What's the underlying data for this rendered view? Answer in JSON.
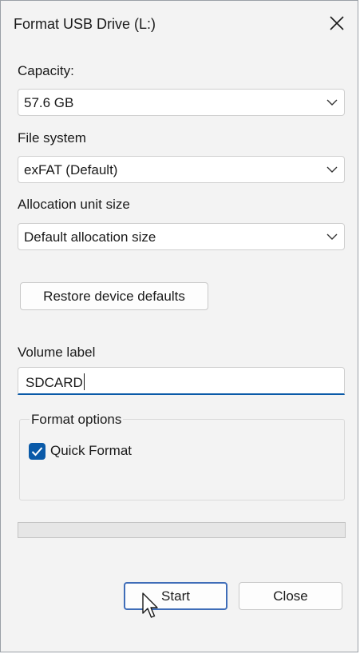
{
  "window": {
    "title": "Format USB Drive (L:)",
    "close_icon": "close-icon"
  },
  "capacity": {
    "label": "Capacity:",
    "value": "57.6 GB"
  },
  "file_system": {
    "label": "File system",
    "value": "exFAT (Default)"
  },
  "allocation": {
    "label": "Allocation unit size",
    "value": "Default allocation size"
  },
  "restore_button": "Restore device defaults",
  "volume_label": {
    "label": "Volume label",
    "value": "SDCARD"
  },
  "format_options": {
    "legend": "Format options",
    "quick_format": {
      "label": "Quick Format",
      "checked": true
    }
  },
  "progress": {
    "fraction": 0
  },
  "buttons": {
    "start": "Start",
    "close": "Close"
  },
  "colors": {
    "accent": "#0a5aa8",
    "focus_border": "#3f6db8",
    "window_bg": "#f3f3f3"
  }
}
